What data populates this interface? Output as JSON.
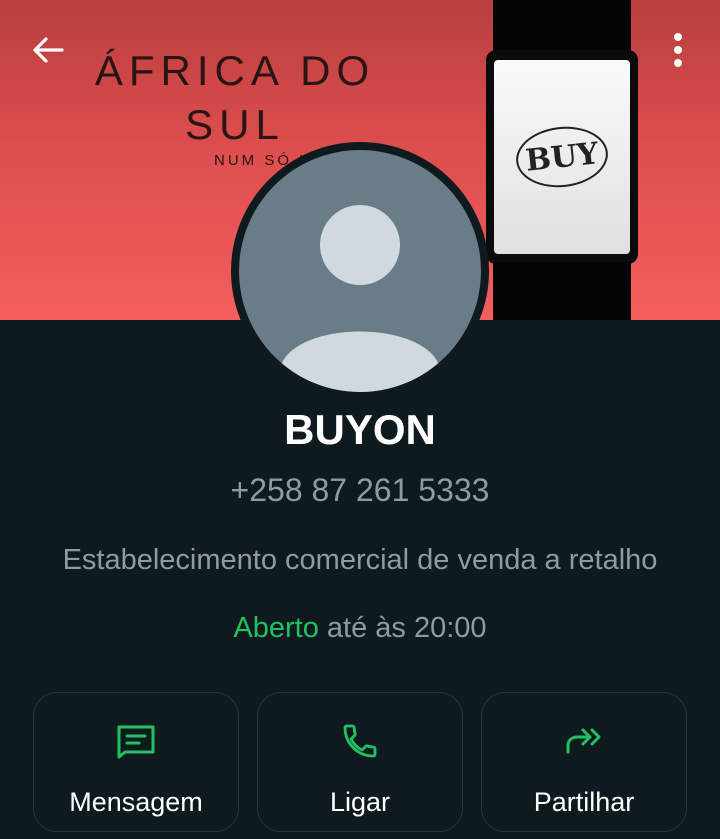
{
  "cover": {
    "title": "ÁFRICA DO SUL",
    "subtitle": "NUM SÓ L",
    "device_logo": "BUY"
  },
  "header": {
    "back_icon": "arrow-left-icon",
    "menu_icon": "more-vertical-icon"
  },
  "profile": {
    "avatar_icon": "default-person-avatar",
    "name": "BUYON",
    "phone": "+258 87 261 5333",
    "category": "Estabelecimento comercial de venda a retalho",
    "hours": {
      "status": "Aberto",
      "detail": " até às 20:00"
    }
  },
  "actions": [
    {
      "label": "Mensagem",
      "icon": "message-icon"
    },
    {
      "label": "Ligar",
      "icon": "phone-icon"
    },
    {
      "label": "Partilhar",
      "icon": "share-forward-icon"
    }
  ],
  "colors": {
    "background": "#0f1a1f",
    "accent": "#21c063",
    "muted_text": "#8d9ba3",
    "cover": "#e25252"
  }
}
